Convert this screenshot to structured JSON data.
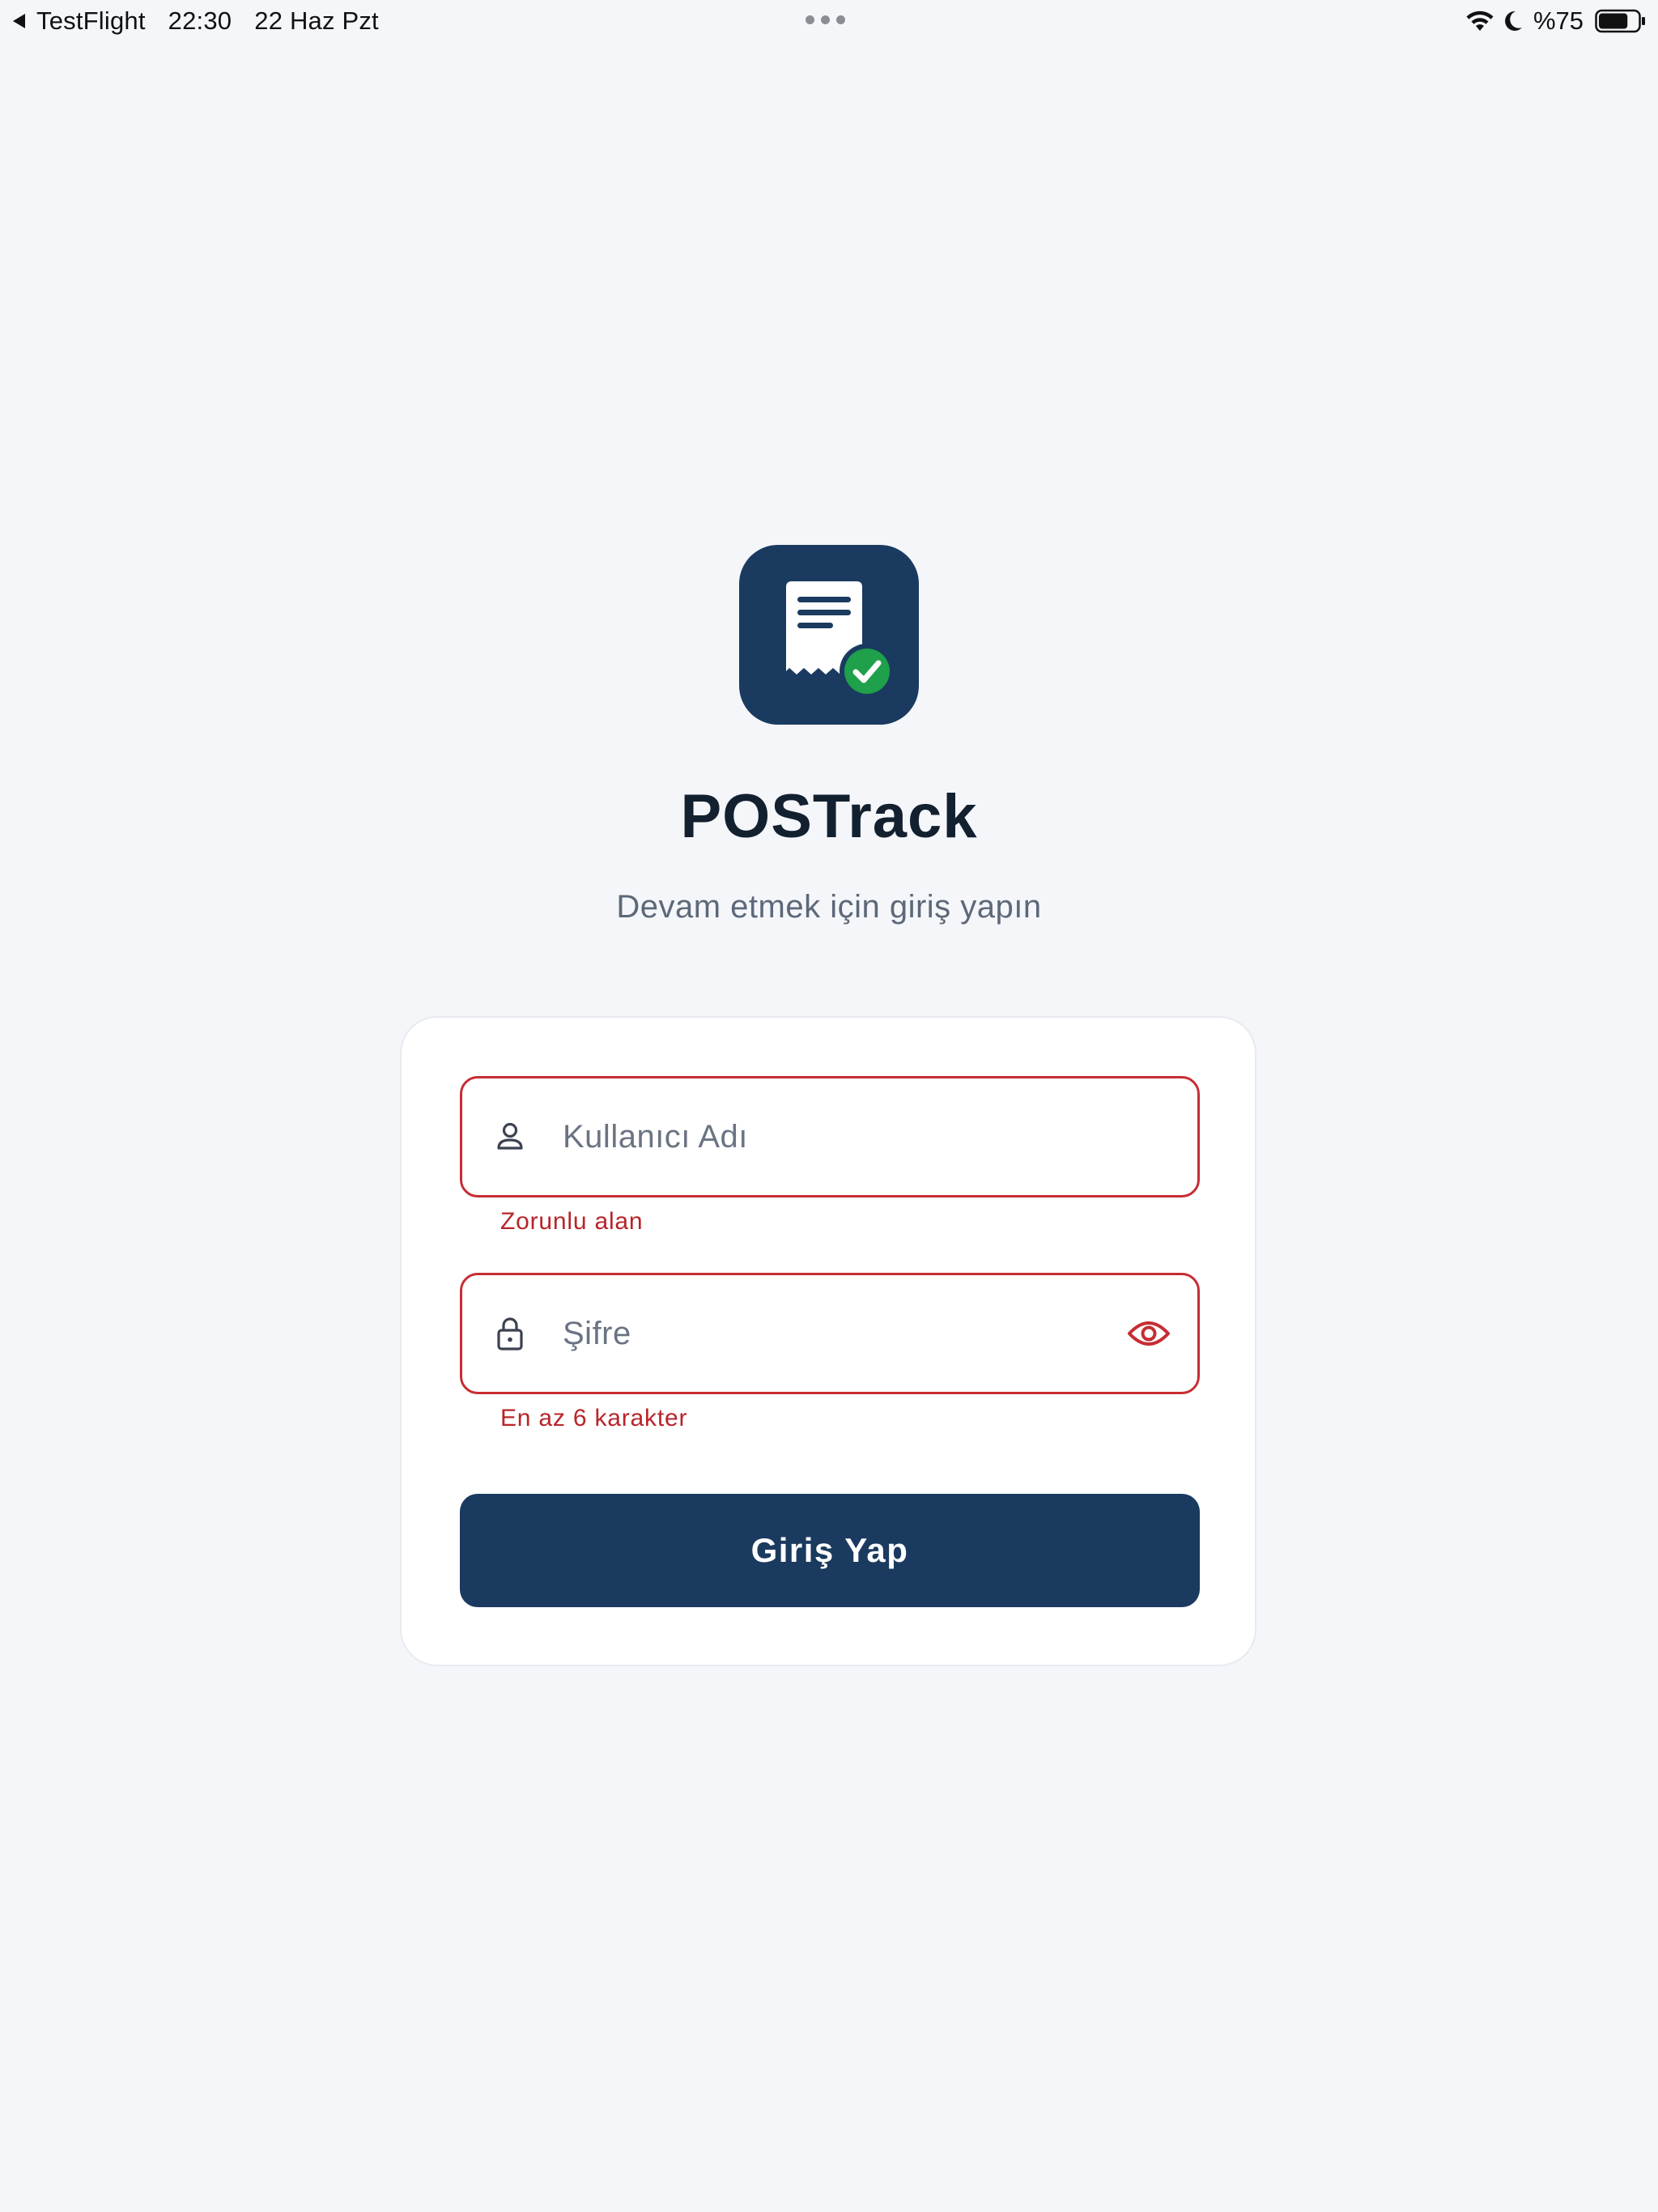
{
  "status_bar": {
    "back_app": "TestFlight",
    "time": "22:30",
    "date": "22 Haz Pzt",
    "battery_text": "%75",
    "battery_level": 0.75,
    "icons": [
      "back-caret-icon",
      "wifi-icon",
      "moon-icon",
      "battery-icon"
    ]
  },
  "header": {
    "logo_icon": "receipt-check-icon",
    "title": "POSTrack",
    "subtitle": "Devam etmek için giriş yapın"
  },
  "form": {
    "username": {
      "placeholder": "Kullanıcı Adı",
      "value": "",
      "icon": "user-icon",
      "error": "Zorunlu alan"
    },
    "password": {
      "placeholder": "Şifre",
      "value": "",
      "icon": "lock-icon",
      "toggle_icon": "eye-icon",
      "error": "En az 6 karakter"
    },
    "submit_label": "Giriş Yap"
  },
  "colors": {
    "primary": "#1b3a5f",
    "error": "#c62d33",
    "success": "#1fa04a",
    "background": "#f4f6fa"
  }
}
